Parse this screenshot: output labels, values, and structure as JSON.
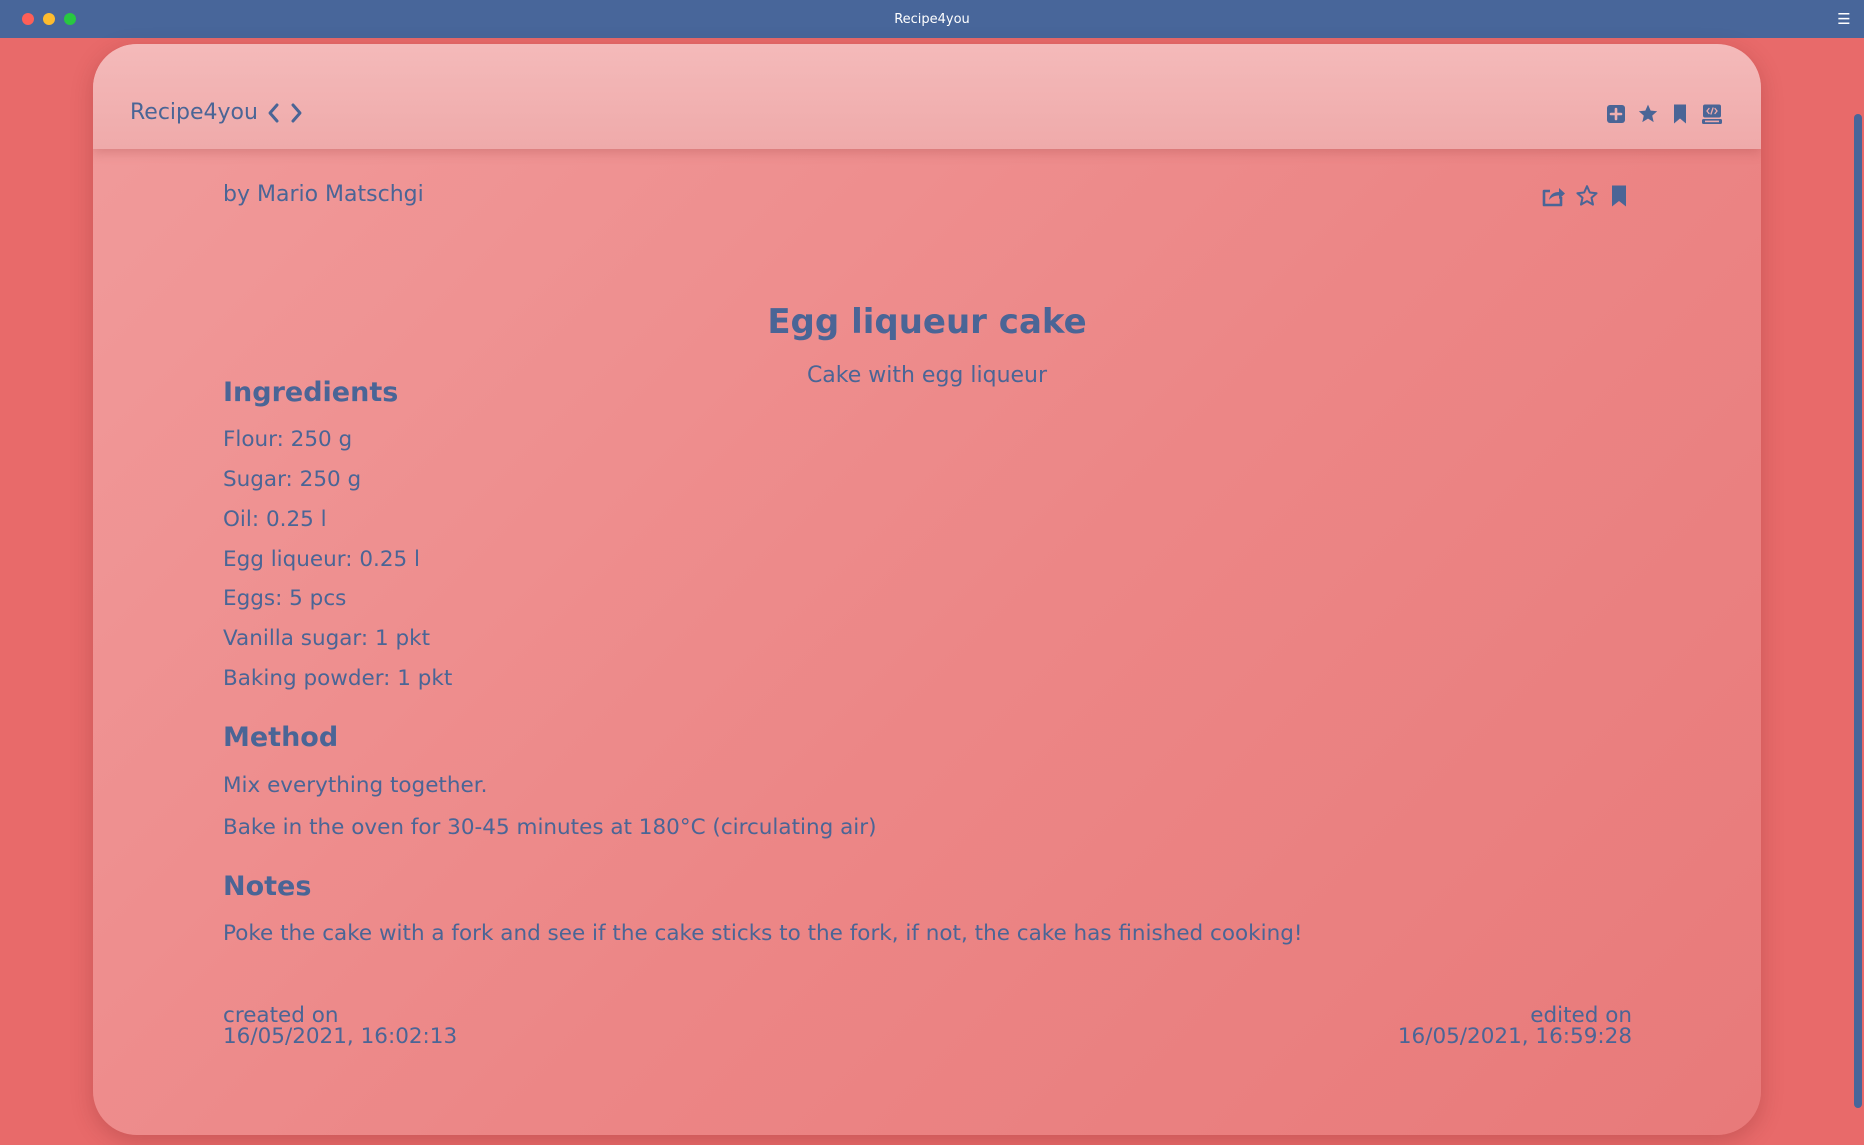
{
  "window": {
    "title": "Recipe4you",
    "menu_icon": "hamburger-menu-icon"
  },
  "header": {
    "brand": "Recipe4you",
    "nav": {
      "back_icon": "chevron-left-icon",
      "forward_icon": "chevron-right-icon"
    },
    "actions": [
      {
        "name": "add-recipe-button",
        "icon": "plus-square-icon"
      },
      {
        "name": "favorites-button",
        "icon": "star-icon"
      },
      {
        "name": "bookmarks-button",
        "icon": "bookmark-icon"
      },
      {
        "name": "code-button",
        "icon": "code-terminal-icon"
      }
    ]
  },
  "recipe": {
    "author": "by Mario Matschgi",
    "actions": [
      {
        "name": "share-button",
        "icon": "share-icon"
      },
      {
        "name": "favorite-toggle",
        "icon": "star-outline-icon"
      },
      {
        "name": "bookmark-toggle",
        "icon": "bookmark-icon"
      }
    ],
    "title": "Egg liqueur cake",
    "subtitle": "Cake with egg liqueur",
    "ingredients_heading": "Ingredients",
    "ingredients": [
      "Flour: 250 g",
      "Sugar: 250 g",
      "Oil: 0.25 l",
      "Egg liqueur: 0.25 l",
      "Eggs: 5 pcs",
      "Vanilla sugar: 1 pkt",
      "Baking powder: 1 pkt"
    ],
    "method_heading": "Method",
    "method": [
      "Mix everything together.",
      "Bake in the oven for 30-45 minutes at 180°C (circulating air)"
    ],
    "notes_heading": "Notes",
    "notes": "Poke the cake with a fork and see if the cake sticks to the fork, if not, the cake has finished cooking!",
    "created_label": "created on",
    "created_value": "16/05/2021, 16:02:13",
    "edited_label": "edited on",
    "edited_value": "16/05/2021, 16:59:28"
  },
  "colors": {
    "background": "#e86a6a",
    "titlebar": "#48669a",
    "accent_text": "#4a6596",
    "card_top": "#f4baba"
  }
}
